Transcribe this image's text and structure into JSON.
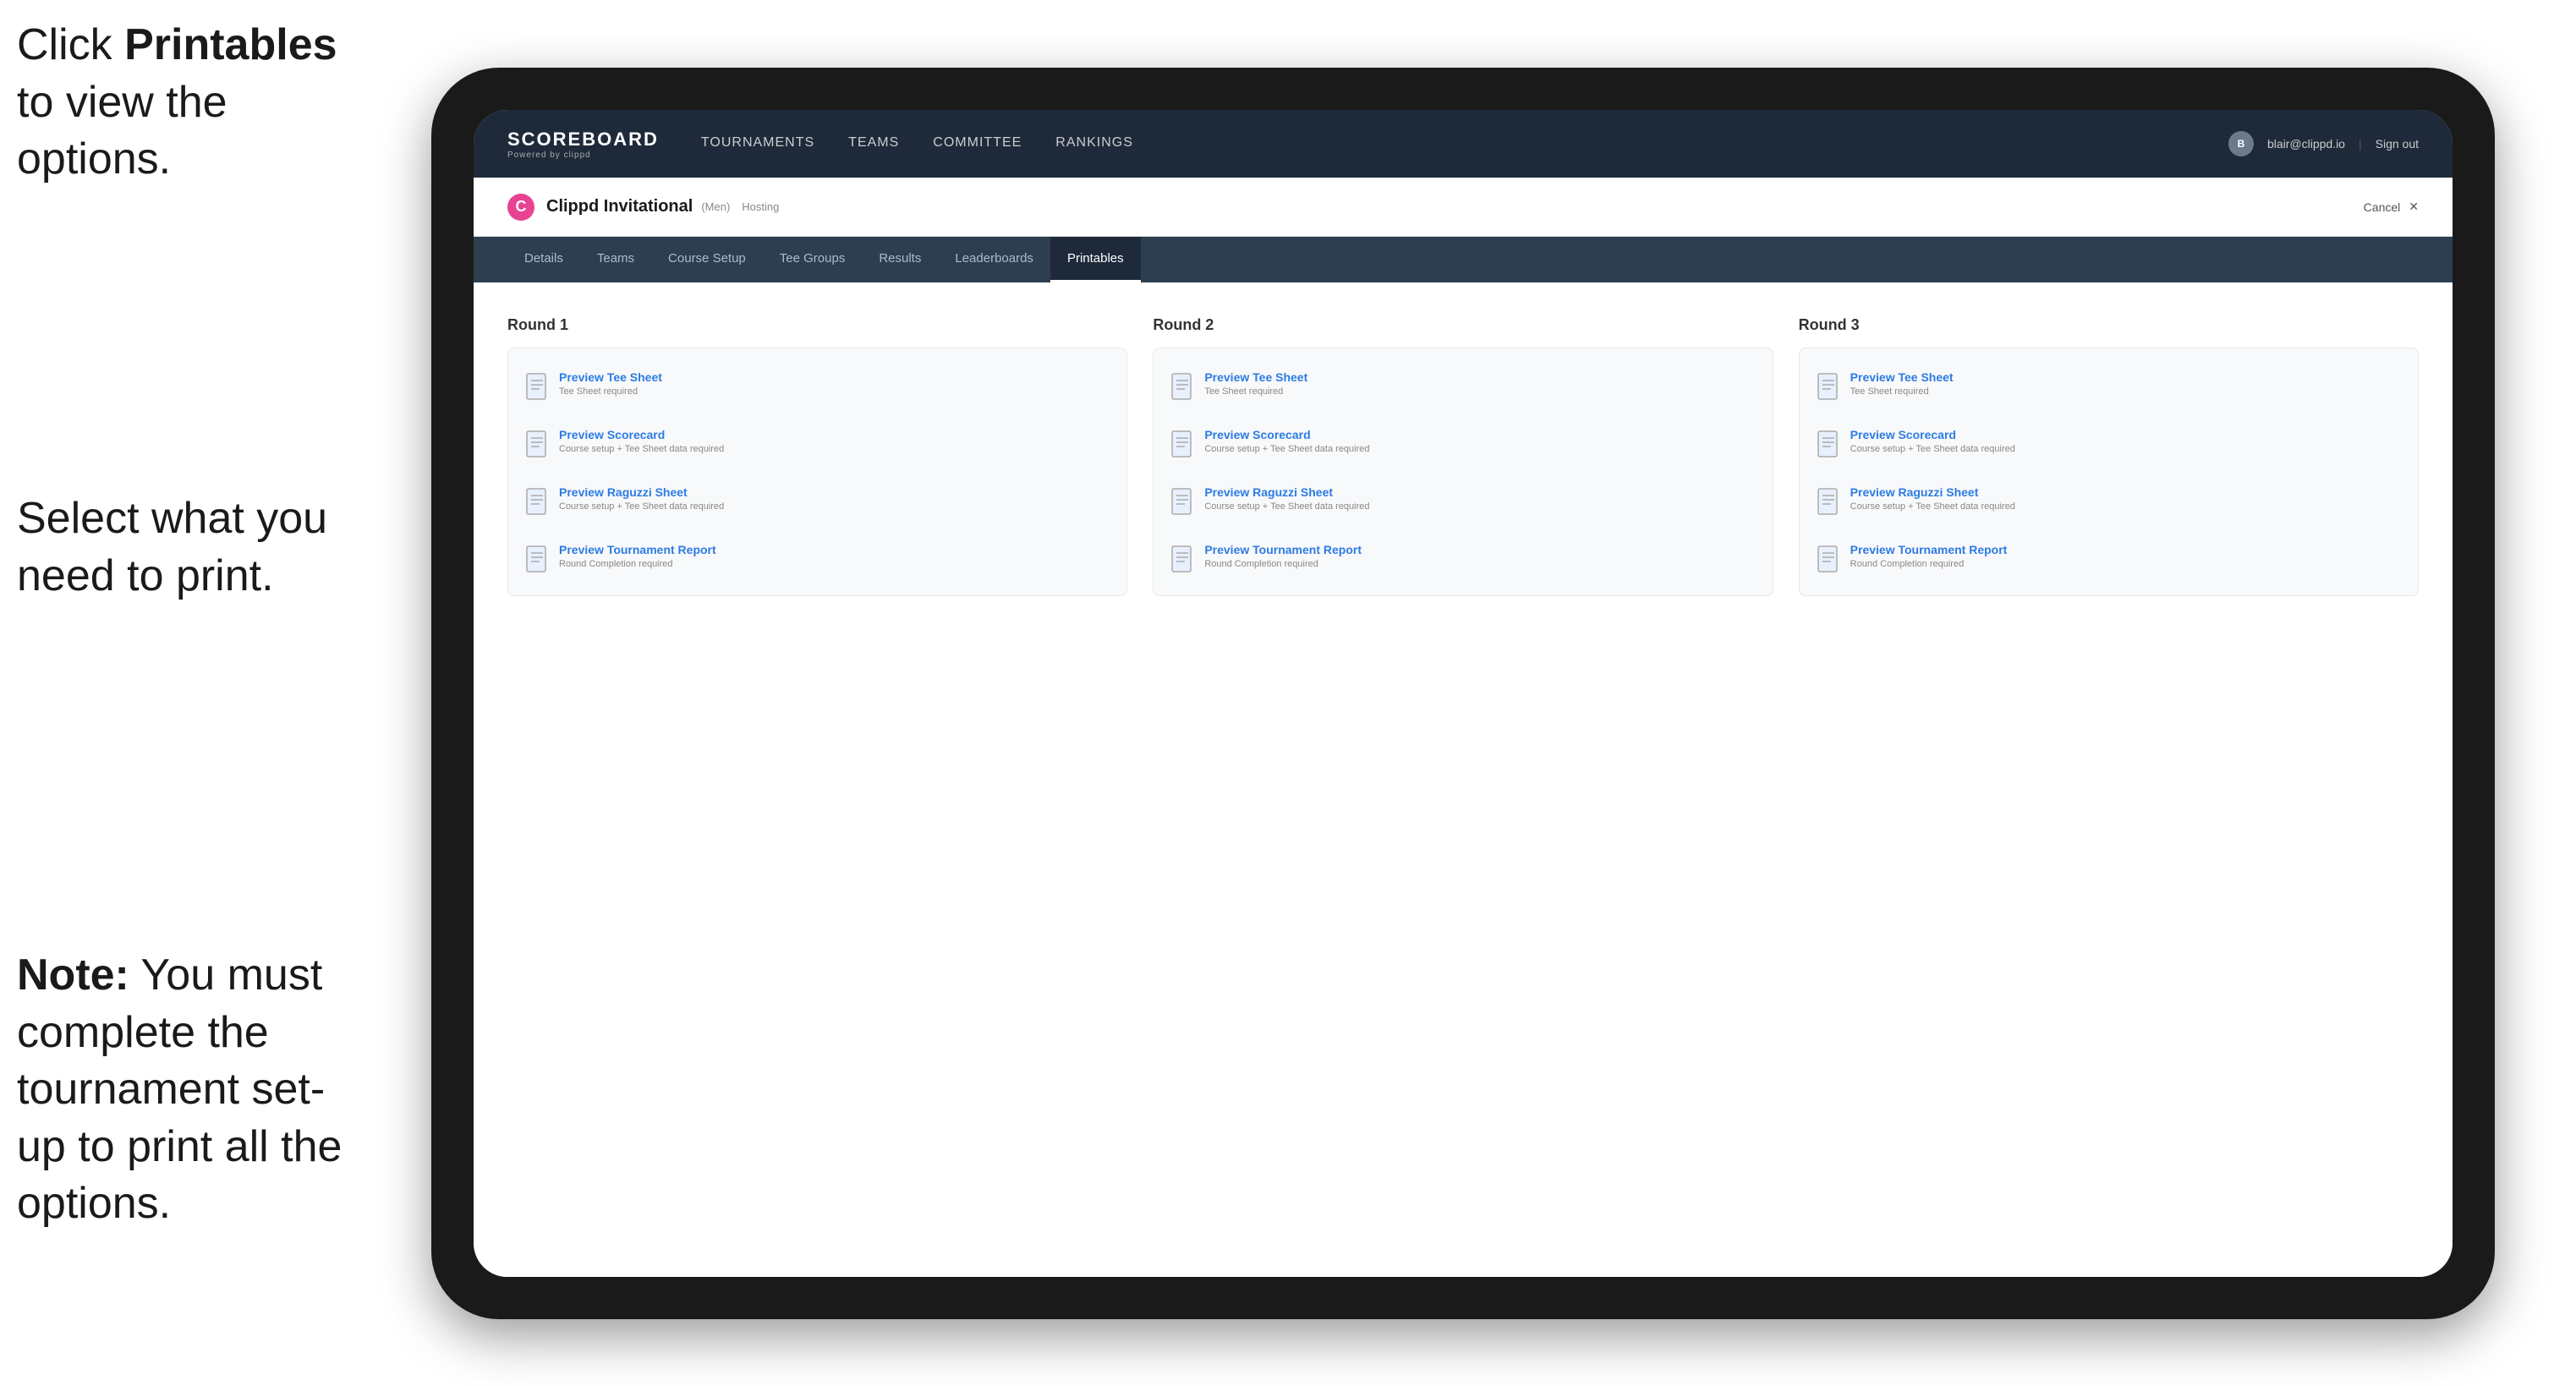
{
  "annotations": {
    "top": {
      "prefix": "Click ",
      "bold": "Printables",
      "suffix": " to view the options."
    },
    "middle": {
      "text": "Select what you need to print."
    },
    "bottom": {
      "bold": "Note:",
      "suffix": " You must complete the tournament set-up to print all the options."
    }
  },
  "nav": {
    "logo_title": "SCOREBOARD",
    "logo_subtitle": "Powered by clippd",
    "links": [
      {
        "label": "TOURNAMENTS",
        "active": false
      },
      {
        "label": "TEAMS",
        "active": false
      },
      {
        "label": "COMMITTEE",
        "active": false
      },
      {
        "label": "RANKINGS",
        "active": false
      }
    ],
    "user_email": "blair@clippd.io",
    "sign_out": "Sign out",
    "separator": "|"
  },
  "sub_header": {
    "tournament_name": "Clippd Invitational",
    "tournament_tag": "(Men)",
    "hosting_badge": "Hosting",
    "cancel_label": "Cancel",
    "cancel_icon": "✕"
  },
  "tabs": [
    {
      "label": "Details",
      "active": false
    },
    {
      "label": "Teams",
      "active": false
    },
    {
      "label": "Course Setup",
      "active": false
    },
    {
      "label": "Tee Groups",
      "active": false
    },
    {
      "label": "Results",
      "active": false
    },
    {
      "label": "Leaderboards",
      "active": false
    },
    {
      "label": "Printables",
      "active": true
    }
  ],
  "rounds": [
    {
      "title": "Round 1",
      "items": [
        {
          "title": "Preview Tee Sheet",
          "subtitle": "Tee Sheet required"
        },
        {
          "title": "Preview Scorecard",
          "subtitle": "Course setup + Tee Sheet data required"
        },
        {
          "title": "Preview Raguzzi Sheet",
          "subtitle": "Course setup + Tee Sheet data required"
        },
        {
          "title": "Preview Tournament Report",
          "subtitle": "Round Completion required"
        }
      ]
    },
    {
      "title": "Round 2",
      "items": [
        {
          "title": "Preview Tee Sheet",
          "subtitle": "Tee Sheet required"
        },
        {
          "title": "Preview Scorecard",
          "subtitle": "Course setup + Tee Sheet data required"
        },
        {
          "title": "Preview Raguzzi Sheet",
          "subtitle": "Course setup + Tee Sheet data required"
        },
        {
          "title": "Preview Tournament Report",
          "subtitle": "Round Completion required"
        }
      ]
    },
    {
      "title": "Round 3",
      "items": [
        {
          "title": "Preview Tee Sheet",
          "subtitle": "Tee Sheet required"
        },
        {
          "title": "Preview Scorecard",
          "subtitle": "Course setup + Tee Sheet data required"
        },
        {
          "title": "Preview Raguzzi Sheet",
          "subtitle": "Course setup + Tee Sheet data required"
        },
        {
          "title": "Preview Tournament Report",
          "subtitle": "Round Completion required"
        }
      ]
    }
  ]
}
